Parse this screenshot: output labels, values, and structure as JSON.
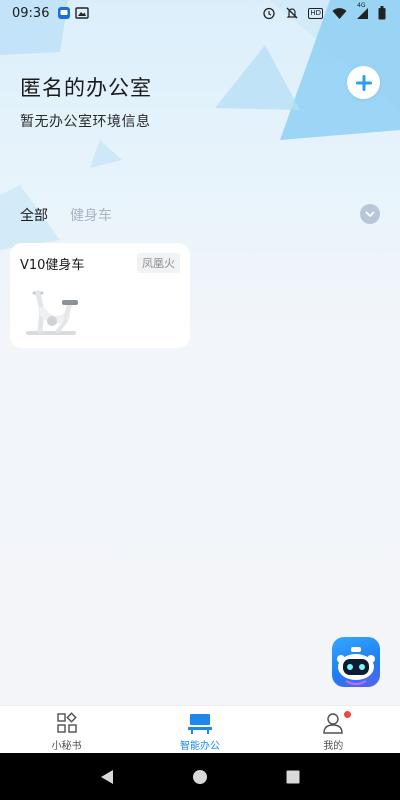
{
  "status_bar": {
    "time": "09:36",
    "network_label": "4G",
    "hd_label": "HD"
  },
  "header": {
    "title": "匿名的办公室",
    "subtitle": "暂无办公室环境信息",
    "add_icon": "plus-icon"
  },
  "filters": {
    "tabs": [
      {
        "label": "全部",
        "active": true
      },
      {
        "label": "健身车",
        "active": false
      }
    ],
    "expand_icon": "chevron-down-icon"
  },
  "devices": [
    {
      "name": "V10健身车",
      "brand": "凤凰火",
      "image": "exercise-bike-image"
    }
  ],
  "assistant": {
    "icon": "robot-assistant-icon"
  },
  "bottom_nav": {
    "items": [
      {
        "label": "小秘书",
        "icon": "grid-icon",
        "active": false
      },
      {
        "label": "智能办公",
        "icon": "desk-icon",
        "active": true
      },
      {
        "label": "我的",
        "icon": "user-icon",
        "active": false,
        "badge": true
      }
    ]
  },
  "colors": {
    "accent": "#1d87ee",
    "badge": "#f2453d",
    "background": "#f3f5f9"
  }
}
